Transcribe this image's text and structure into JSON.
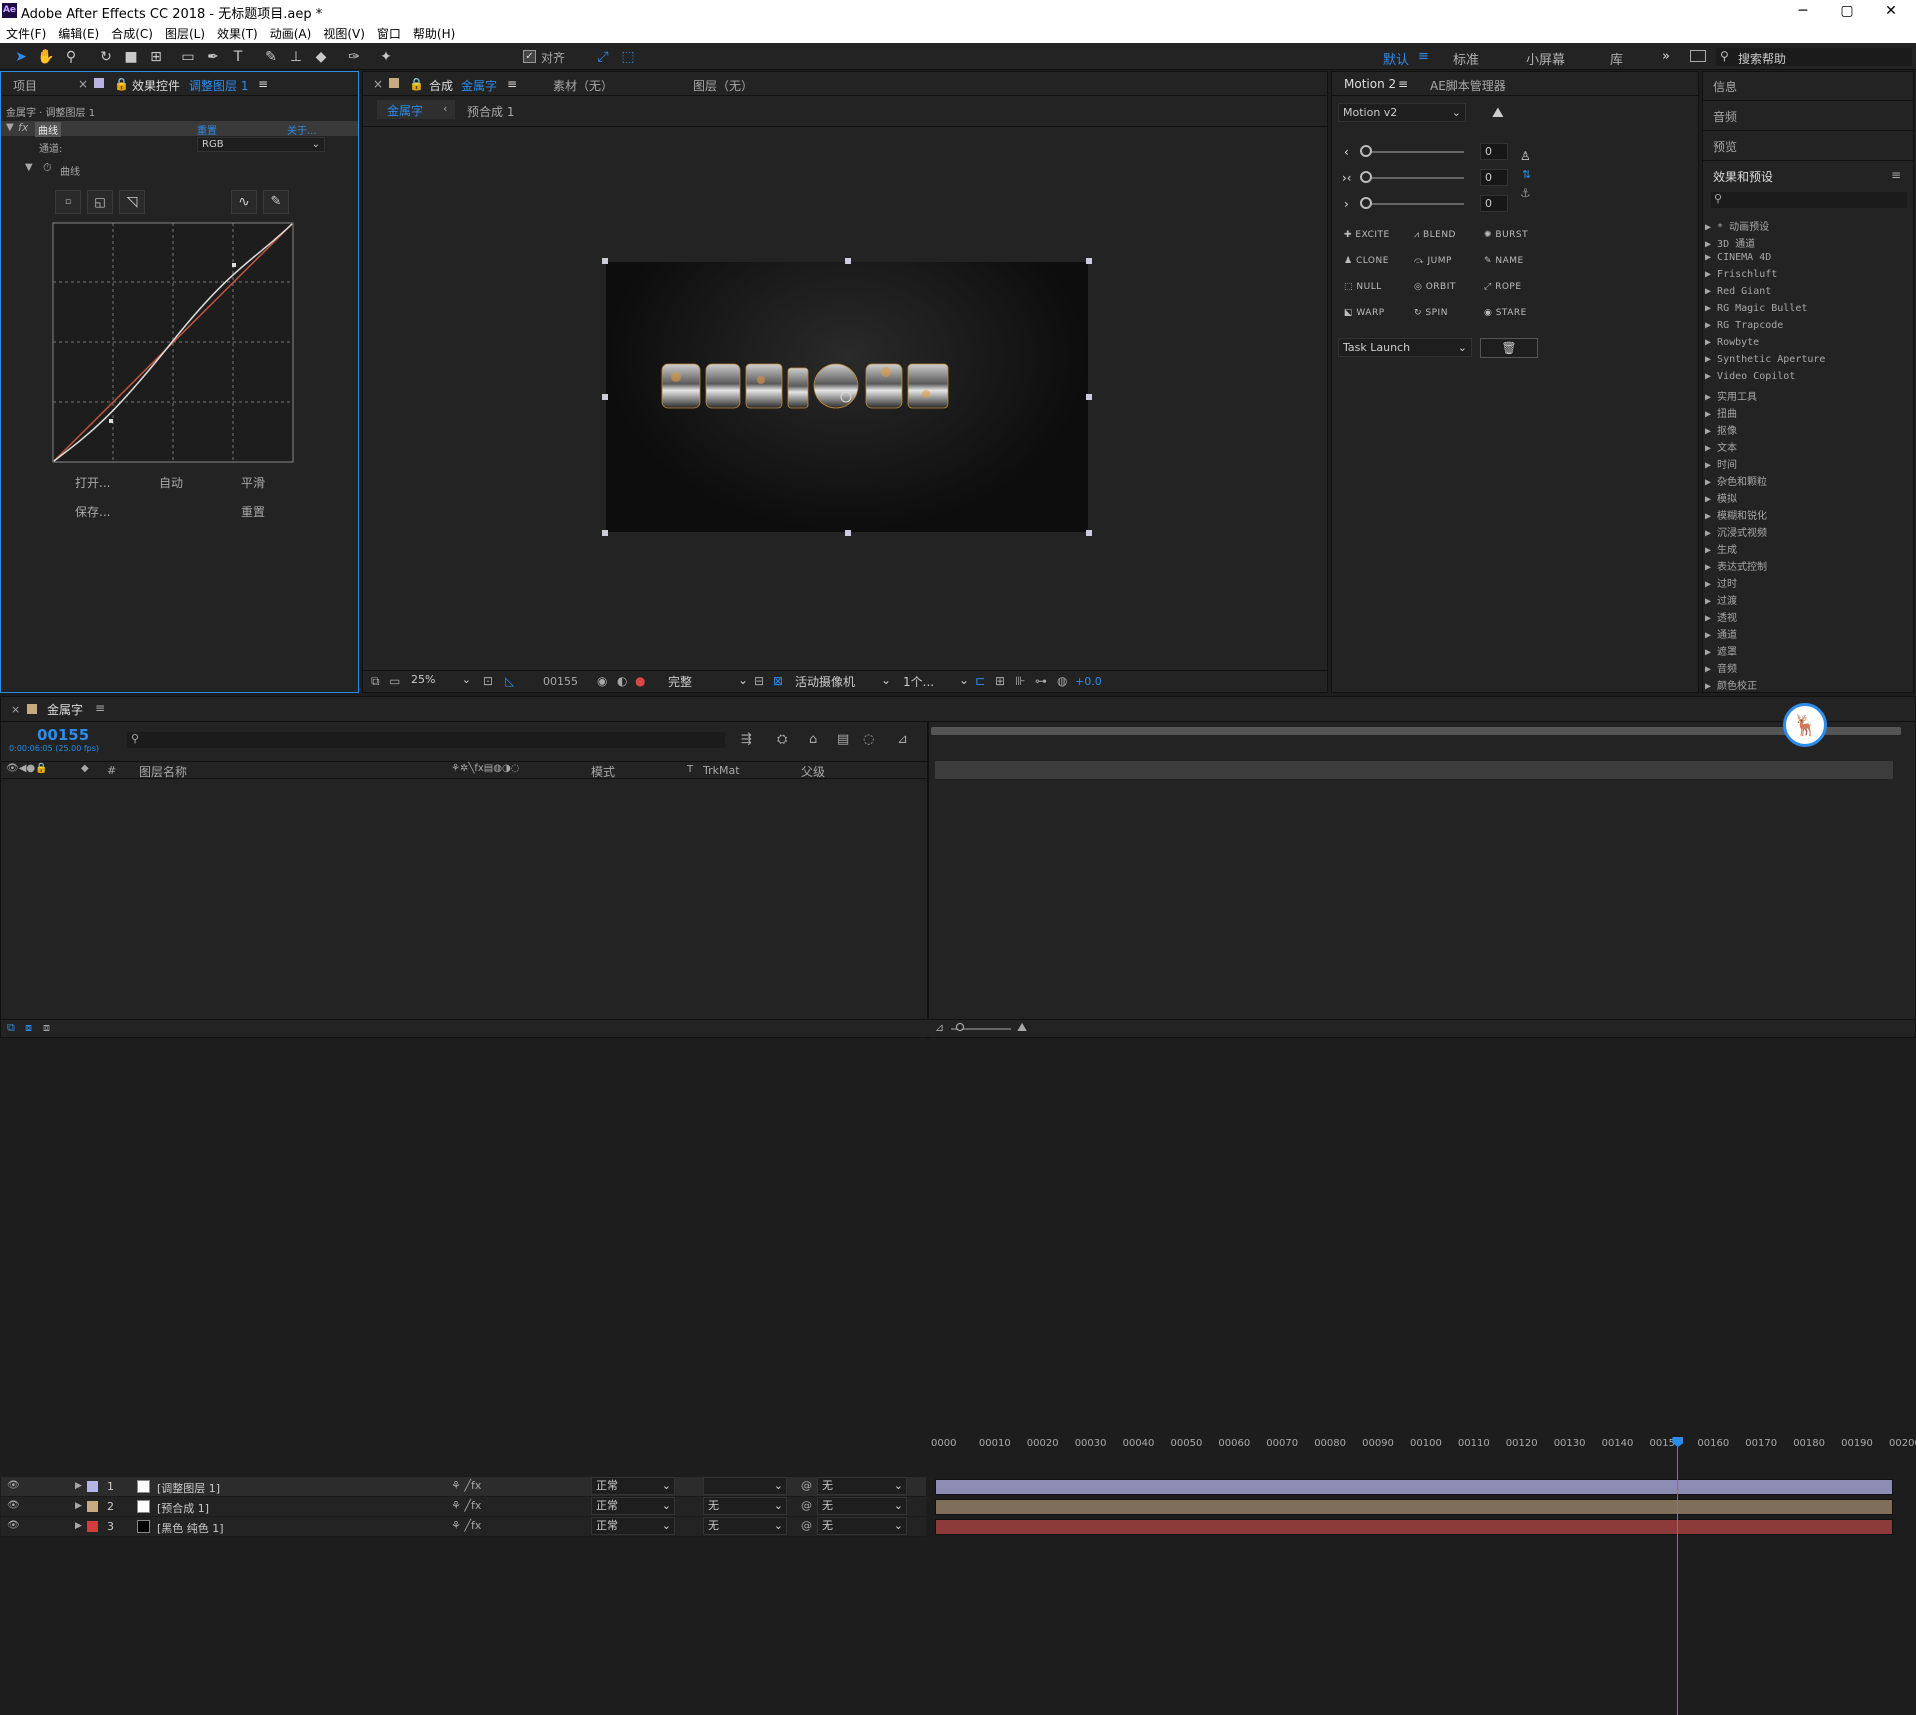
{
  "app": {
    "title": "Adobe After Effects CC 2018 - 无标题项目.aep *",
    "logo": "Ae"
  },
  "window_controls": {
    "minimize": "─",
    "maximize": "▢",
    "close": "✕"
  },
  "menu": [
    "文件(F)",
    "编辑(E)",
    "合成(C)",
    "图层(L)",
    "效果(T)",
    "动画(A)",
    "视图(V)",
    "窗口",
    "帮助(H)"
  ],
  "toolbar": {
    "align_label": "对齐",
    "workspaces": [
      "默认",
      "标准",
      "小屏幕",
      "库"
    ],
    "overflow": "»",
    "search_placeholder": "搜索帮助"
  },
  "left_panel": {
    "tab_project": "项目",
    "tab_effects_prefix": "效果控件",
    "tab_effects_layer": "调整图层 1",
    "breadcrumb": "金属字 · 调整图层 1",
    "effect_name": "曲线",
    "reset_label": "重置",
    "about_label": "关于...",
    "channel_label": "通道:",
    "channel_value": "RGB",
    "curves_label": "曲线",
    "buttons": {
      "open": "打开...",
      "auto": "自动",
      "smooth": "平滑",
      "save": "保存...",
      "reset": "重置"
    }
  },
  "comp_panel": {
    "tab_comp_prefix": "合成",
    "tab_comp_name": "金属字",
    "tab_footage": "素材（无）",
    "tab_layer": "图层（无）",
    "flow_active": "金属字",
    "flow_next": "预合成 1",
    "zoom": "25%",
    "timecode": "00155",
    "quality": "完整",
    "camera": "活动摄像机",
    "views": "1个...",
    "exposure": "+0.0"
  },
  "motion_panel": {
    "tab_motion": "Motion 2",
    "tab_script": "AE脚本管理器",
    "preset": "Motion v2",
    "slider_values": [
      "0",
      "0",
      "0"
    ],
    "buttons": [
      "EXCITE",
      "BLEND",
      "BURST",
      "CLONE",
      "JUMP",
      "NAME",
      "NULL",
      "ORBIT",
      "ROPE",
      "WARP",
      "SPIN",
      "STARE"
    ],
    "task": "Task Launch"
  },
  "right_panel": {
    "items": [
      "信息",
      "音频",
      "预览"
    ],
    "effects_title": "效果和预设",
    "effects": [
      "* 动画预设",
      "3D 通道",
      "CINEMA 4D",
      "Frischluft",
      "Red Giant",
      "RG Magic Bullet",
      "RG Trapcode",
      "Rowbyte",
      "Synthetic Aperture",
      "Video Copilot",
      "实用工具",
      "扭曲",
      "抠像",
      "文本",
      "时间",
      "杂色和颗粒",
      "模拟",
      "模糊和锐化",
      "沉浸式视频",
      "生成",
      "表达式控制",
      "过时",
      "过渡",
      "透视",
      "通道",
      "遮罩",
      "音频",
      "颜色校正"
    ]
  },
  "timeline": {
    "comp_name": "金属字",
    "timecode": "00155",
    "timecode_sub": "0:00:06:05 (25.00 fps)",
    "columns": {
      "num": "#",
      "name": "图层名称",
      "mode": "模式",
      "t": "T",
      "trkmat": "TrkMat",
      "parent": "父级"
    },
    "layers": [
      {
        "num": "1",
        "name": "[调整图层 1]",
        "mode": "正常",
        "trkmat": "",
        "parent": "无",
        "color": "#b4b4e6",
        "bar": "#8c8cb4"
      },
      {
        "num": "2",
        "name": "[预合成 1]",
        "mode": "正常",
        "trkmat": "无",
        "parent": "无",
        "color": "#c8aa82",
        "bar": "#7e6e5a"
      },
      {
        "num": "3",
        "name": "[黑色 纯色 1]",
        "mode": "正常",
        "trkmat": "无",
        "parent": "无",
        "color": "#d23c3c",
        "bar": "#8c3a3a"
      }
    ],
    "ruler": [
      "0000",
      "00010",
      "00020",
      "00030",
      "00040",
      "00050",
      "00060",
      "00070",
      "00080",
      "00090",
      "00100",
      "00110",
      "00120",
      "00130",
      "00140",
      "00150",
      "00160",
      "00170",
      "00180",
      "00190",
      "00200"
    ],
    "playhead_frame": 155,
    "total_frames": 200
  }
}
